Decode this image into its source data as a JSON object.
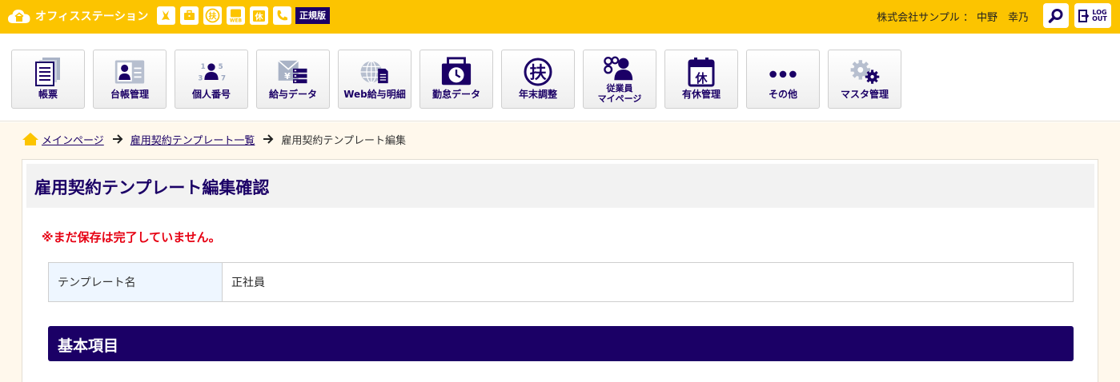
{
  "header": {
    "brand_name": "オフィスステーション",
    "edition_badge": "正規版",
    "company_user": "株式会社サンプル ： 中野　幸乃",
    "mini_icons": [
      "labor-icon",
      "briefcase-icon",
      "support-icon",
      "web-icon",
      "holiday-icon",
      "phone-icon"
    ],
    "logout_line1": "LOG",
    "logout_line2": "OUT"
  },
  "nav": {
    "items": [
      {
        "label": "帳票",
        "icon": "ledger-icon"
      },
      {
        "label": "台帳管理",
        "icon": "register-icon"
      },
      {
        "label": "個人番号",
        "icon": "my-number-icon"
      },
      {
        "label": "給与データ",
        "icon": "payroll-data-icon"
      },
      {
        "label": "Web給与明細",
        "icon": "web-payslip-icon"
      },
      {
        "label": "勤怠データ",
        "icon": "attendance-icon"
      },
      {
        "label": "年末調整",
        "icon": "year-end-adjustment-icon"
      },
      {
        "label_line1": "従業員",
        "label_line2": "マイページ",
        "icon": "employee-mypage-icon"
      },
      {
        "label": "有休管理",
        "icon": "paid-leave-icon"
      },
      {
        "label": "その他",
        "icon": "more-icon"
      },
      {
        "label": "マスタ管理",
        "icon": "master-settings-icon"
      }
    ]
  },
  "breadcrumb": {
    "items": [
      "メインページ",
      "雇用契約テンプレート一覧",
      "雇用契約テンプレート編集"
    ]
  },
  "page": {
    "title": "雇用契約テンプレート編集確認",
    "warning": "※まだ保存は完了していません。",
    "table": {
      "label": "テンプレート名",
      "value": "正社員"
    },
    "section_title": "基本項目"
  },
  "colors": {
    "brand_yellow": "#fcc400",
    "navy": "#1b0066",
    "warning_red": "#e60012",
    "content_bg": "#fff8ec"
  }
}
